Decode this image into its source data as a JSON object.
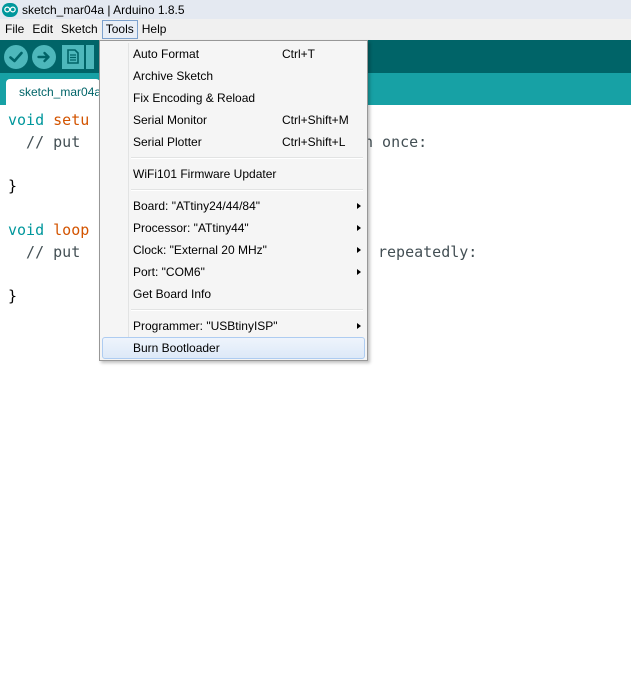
{
  "window": {
    "title": "sketch_mar04a | Arduino 1.8.5",
    "logo_icon": "arduino-logo-icon"
  },
  "menubar": {
    "items": [
      {
        "label": "File"
      },
      {
        "label": "Edit"
      },
      {
        "label": "Sketch"
      },
      {
        "label": "Tools",
        "active": true
      },
      {
        "label": "Help"
      }
    ]
  },
  "toolbar": {
    "buttons": [
      {
        "icon": "verify-check-icon"
      },
      {
        "icon": "upload-arrow-icon"
      },
      {
        "icon": "new-file-icon"
      }
    ]
  },
  "tabs": [
    {
      "label": "sketch_mar04a"
    }
  ],
  "editor": {
    "lines": [
      {
        "type": "void",
        "name": "setu",
        "rest": ""
      },
      {
        "comment_left": "  // put ",
        "comment_right": "n once:"
      },
      {
        "text": "}"
      },
      {
        "type": "void",
        "name": "loop",
        "rest": ""
      },
      {
        "comment_left": "  // put ",
        "comment_right": "repeatedly:"
      },
      {
        "text": "}"
      }
    ]
  },
  "tools_menu": {
    "items": [
      {
        "label": "Auto Format",
        "shortcut": "Ctrl+T"
      },
      {
        "label": "Archive Sketch"
      },
      {
        "label": "Fix Encoding & Reload"
      },
      {
        "label": "Serial Monitor",
        "shortcut": "Ctrl+Shift+M"
      },
      {
        "label": "Serial Plotter",
        "shortcut": "Ctrl+Shift+L"
      },
      {
        "label": "WiFi101 Firmware Updater"
      },
      {
        "label": "Board: \"ATtiny24/44/84\"",
        "submenu": true
      },
      {
        "label": "Processor: \"ATtiny44\"",
        "submenu": true
      },
      {
        "label": "Clock: \"External 20 MHz\"",
        "submenu": true
      },
      {
        "label": "Port: \"COM6\"",
        "submenu": true
      },
      {
        "label": "Get Board Info"
      },
      {
        "label": "Programmer: \"USBtinyISP\"",
        "submenu": true
      },
      {
        "label": "Burn Bootloader",
        "highlighted": true
      }
    ]
  },
  "colors": {
    "toolbar": "#006468",
    "tab_strip": "#17a1a5",
    "button": "#4db7bb",
    "keyword": "#00979c",
    "function": "#d35400"
  }
}
